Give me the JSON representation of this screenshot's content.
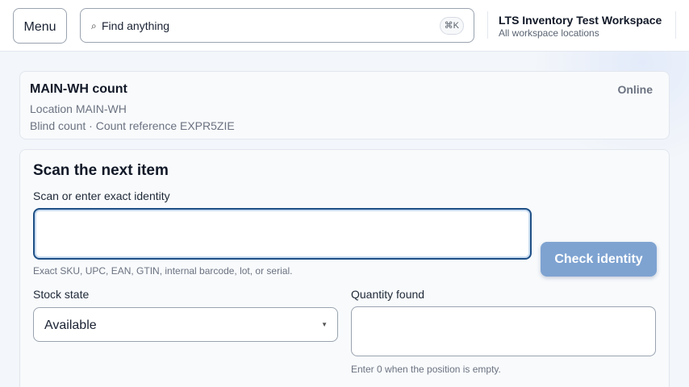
{
  "header": {
    "menu_label": "Menu",
    "search_placeholder": "Find anything",
    "search_shortcut": "⌘K",
    "workspace_title": "LTS Inventory Test Workspace",
    "workspace_subtitle": "All workspace locations"
  },
  "count": {
    "title": "MAIN-WH count",
    "status": "Online",
    "location": "Location MAIN-WH",
    "reference": "Blind count · Count reference EXPR5ZIE"
  },
  "scan": {
    "title": "Scan the next item",
    "identity_label": "Scan or enter exact identity",
    "identity_value": "",
    "identity_hint": "Exact SKU, UPC, EAN, GTIN, internal barcode, lot, or serial.",
    "check_button": "Check identity",
    "stock_state_label": "Stock state",
    "stock_state_value": "Available",
    "quantity_label": "Quantity found",
    "quantity_value": "",
    "quantity_hint": "Enter 0 when the position is empty."
  },
  "colors": {
    "accent": "#1e4f86",
    "button": "#7ea3d1",
    "muted_text": "#6b7280"
  },
  "icons": {
    "search": "search-icon",
    "select_chevron": "chevron-down-icon"
  }
}
